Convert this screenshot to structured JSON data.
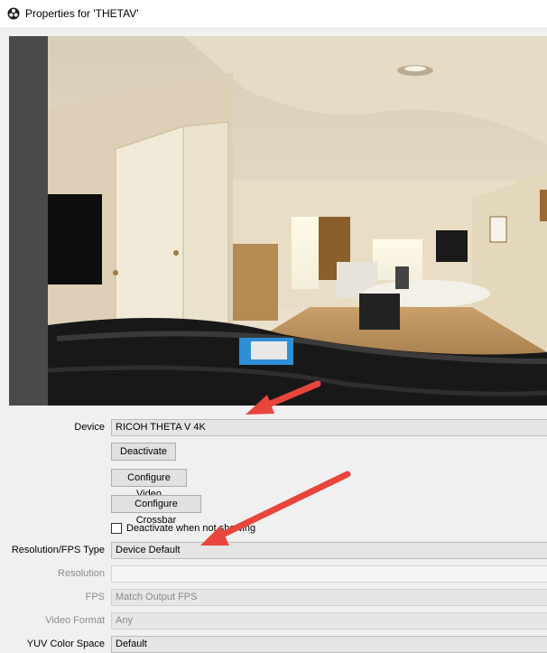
{
  "window": {
    "title": "Properties for 'THETAV'",
    "icon": "obs-icon"
  },
  "preview": {
    "content": "camera-preview-image"
  },
  "form": {
    "device": {
      "label": "Device",
      "value": "RICOH THETA V 4K"
    },
    "buttons": {
      "deactivate": "Deactivate",
      "configure_video": "Configure Video",
      "configure_crossbar": "Configure Crossbar"
    },
    "deactivate_checkbox": {
      "label": "Deactivate when not showing",
      "checked": false
    },
    "resolution_fps_type": {
      "label": "Resolution/FPS Type",
      "value": "Device Default"
    },
    "resolution": {
      "label": "Resolution",
      "value": ""
    },
    "fps": {
      "label": "FPS",
      "value": "Match Output FPS"
    },
    "video_format": {
      "label": "Video Format",
      "value": "Any"
    },
    "yuv_color_space": {
      "label": "YUV Color Space",
      "value": "Default"
    }
  },
  "annotation_color": "#e8453c"
}
